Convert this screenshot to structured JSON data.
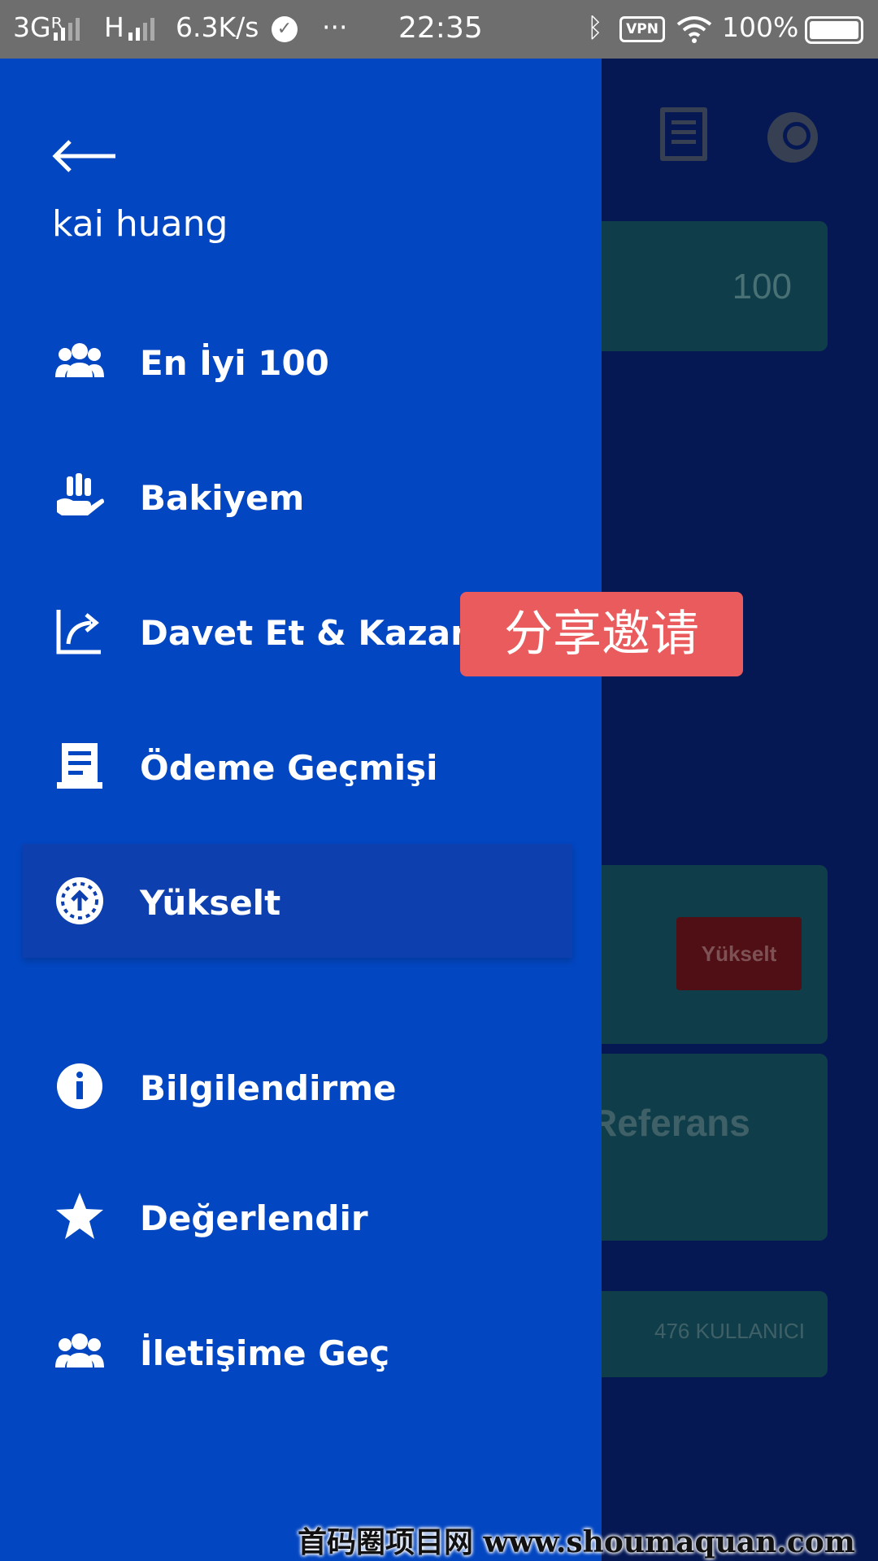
{
  "status_bar": {
    "carrier1": "3Gᴿ",
    "carrier2": "H",
    "net_speed": "6.3K/s",
    "time": "22:35",
    "vpn_label": "VPN",
    "battery": "100%",
    "dots": "···"
  },
  "background": {
    "card_value": "100",
    "upgrade_button": "Yükselt",
    "referans_text": "Referans",
    "users_count": "476 KULLANICI"
  },
  "drawer": {
    "user_name": "kai huang",
    "items": [
      {
        "label": "En İyi 100",
        "icon": "group-icon"
      },
      {
        "label": "Bakiyem",
        "icon": "hand-coins-icon"
      },
      {
        "label": "Davet Et & Kazan",
        "icon": "share-icon"
      },
      {
        "label": "Ödeme Geçmişi",
        "icon": "receipt-icon"
      },
      {
        "label": "Yükselt",
        "icon": "upgrade-icon",
        "active": true
      },
      {
        "label": "Bilgilendirme",
        "icon": "info-icon"
      },
      {
        "label": "Değerlendir",
        "icon": "star-icon"
      },
      {
        "label": "İletişime Geç",
        "icon": "group-icon"
      }
    ]
  },
  "overlay": {
    "share_tag": "分享邀请"
  },
  "watermark": "首码圈项目网 www.shoumaquan.com",
  "colors": {
    "drawer_bg": "#0346c1",
    "active_item_bg": "#0d3fae",
    "share_tag_bg": "#e95b5d"
  }
}
